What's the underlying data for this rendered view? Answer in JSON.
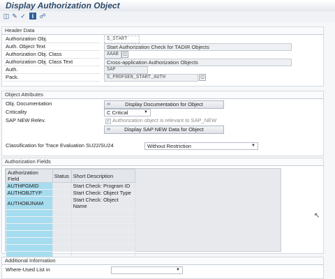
{
  "window": {
    "title": "Display Authorization Object"
  },
  "toolbar": {
    "icons": [
      "display-change-icon",
      "other-object-icon",
      "check-icon",
      "info-icon",
      "where-used-icon"
    ]
  },
  "header": {
    "title": "Header Data",
    "rows": [
      {
        "label": "Authorization Obj.",
        "value": "S_START"
      },
      {
        "label": "Auth. Object Text",
        "value": "Start Authorization Check for TADIR Objects"
      },
      {
        "label": "Authorization Obj. Class",
        "value": "AAAB"
      },
      {
        "label": "Authorization Obj. Class Text",
        "value": "Cross-application Authorization Objects"
      },
      {
        "label": "Auth.",
        "value": "SAP"
      },
      {
        "label": "Pack.",
        "value": "S_PROFGEN_START_AUTH"
      }
    ]
  },
  "attributes": {
    "title": "Object Attributes",
    "obj_doc_label": "Obj. Documentation",
    "obj_doc_button": "Display Documentation for Object",
    "criticality_label": "Criticality",
    "criticality_value": "C Critical",
    "sapnew_label": "SAP NEW Relev.",
    "sapnew_checkbox_label": "Authorization object is relevant to SAP_NEW",
    "sapnew_button": "Display SAP NEW Data for Object",
    "classification_label": "Classification for Trace Evaluation SU22/SU24",
    "classification_value": "Without Restriction"
  },
  "fields": {
    "title": "Authorization Fields",
    "columns": [
      "Authorization Field",
      "Status",
      "Short Description"
    ],
    "rows": [
      {
        "field": "AUTHPGMID",
        "status": "",
        "description": "Start Check: Program ID"
      },
      {
        "field": "AUTHOBJTYP",
        "status": "",
        "description": "Start Check: Object Type"
      },
      {
        "field": "AUTHOBJNAM",
        "status": "",
        "description": "Start Check: Object Name"
      }
    ]
  },
  "additional": {
    "title": "Additional Information",
    "where_used_label": "Where-Used List in",
    "where_used_value": ""
  }
}
